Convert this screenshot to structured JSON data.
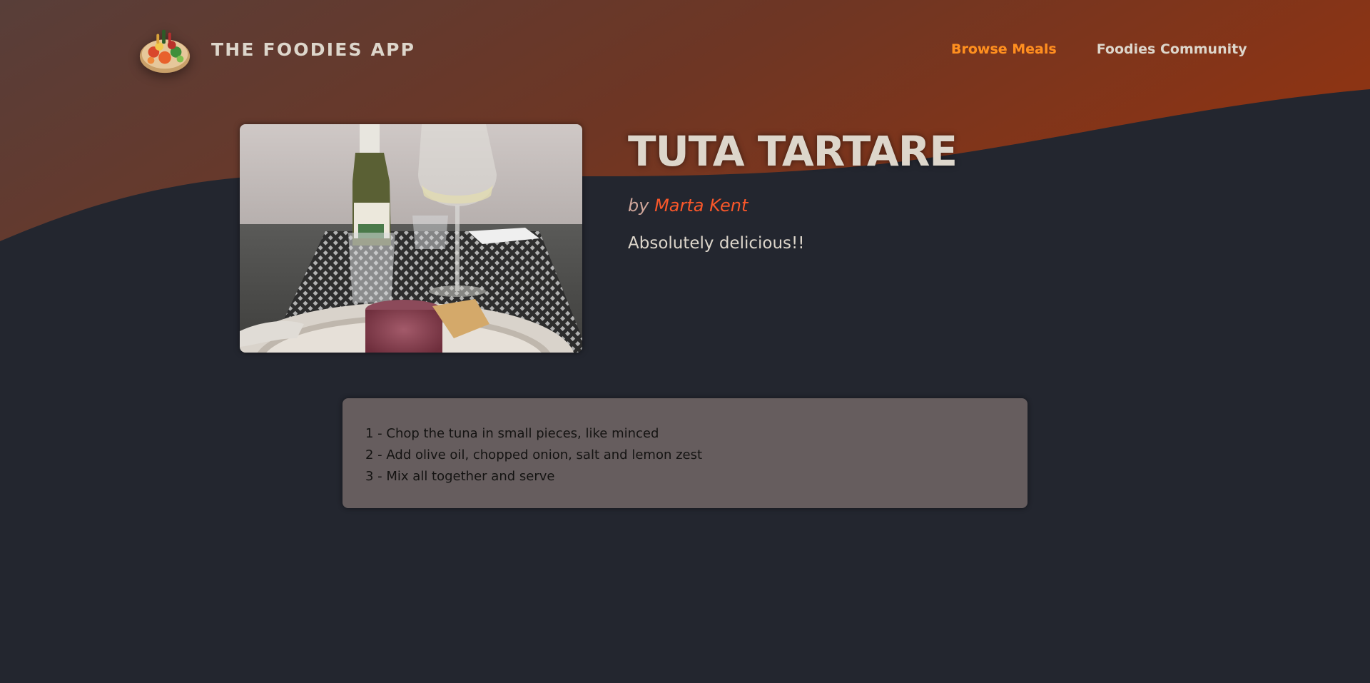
{
  "header": {
    "brand": "THE FOODIES APP",
    "logo_icon": "food-platter-icon",
    "nav": [
      {
        "label": "Browse Meals",
        "active": true
      },
      {
        "label": "Foodies Community",
        "active": false
      }
    ]
  },
  "meal": {
    "title": "TUTA TARTARE",
    "by_prefix": "by",
    "creator": "Marta Kent",
    "summary": "Absolutely delicious!!",
    "image_alt": "tuna tartare on a plate with wine bottle and glasses"
  },
  "instructions": {
    "steps": [
      "1 - Chop the tuna in small pieces, like minced",
      "2 - Add olive oil, chopped onion, salt and lemon zest",
      "3 - Mix all together and serve"
    ]
  },
  "colors": {
    "background": "#23262f",
    "wave_start": "#5a3e38",
    "wave_end": "#8a3416",
    "accent_orange": "#ff8f1f",
    "accent_red": "#f9572a",
    "text_light": "#ddd6cb",
    "instructions_bg": "#6e6464"
  }
}
